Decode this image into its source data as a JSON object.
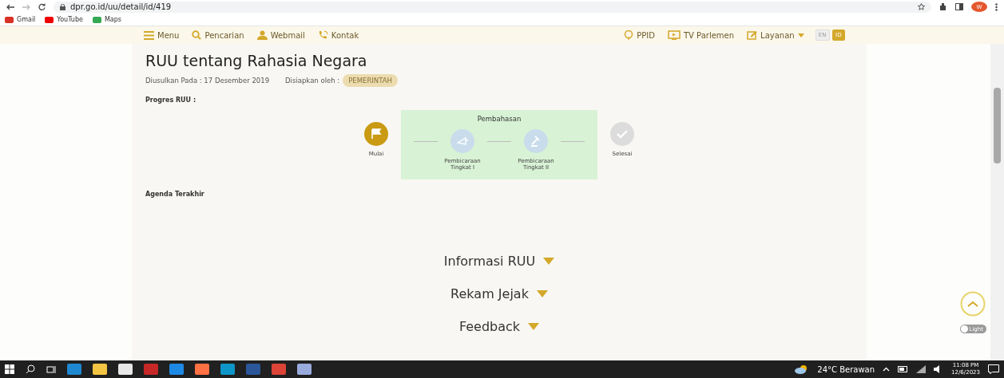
{
  "browser": {
    "url": "dpr.go.id/uu/detail/id/419",
    "bookmarks": [
      "Gmail",
      "YouTube",
      "Maps"
    ],
    "profile": "W"
  },
  "nav": {
    "left": [
      "Menu",
      "Pencarian",
      "Webmail",
      "Kontak"
    ],
    "right": [
      "PPID",
      "TV Parlemen",
      "Layanan"
    ],
    "languages": [
      {
        "label": "EN",
        "selected": false
      },
      {
        "label": "ID",
        "selected": true
      }
    ]
  },
  "bill": {
    "title": "RUU tentang Rahasia Negara",
    "proposed": "Diusulkan Pada : 17 Desember 2019",
    "prepared_label": "Disiapkan oleh :",
    "prepared_by": "PEMERINTAH",
    "progress_label": "Progres RUU :",
    "phase_label": "Pembahasan",
    "steps": [
      {
        "label": "Mulai",
        "done": true
      },
      {
        "label": "Pembicaraan Tingkat I",
        "done": false
      },
      {
        "label": "Pembicaraan Tingkat II",
        "done": false
      },
      {
        "label": "Selesai",
        "done": false
      }
    ],
    "agenda_label": "Agenda Terakhir"
  },
  "sections": [
    {
      "label": "Informasi RUU",
      "expanded": false
    },
    {
      "label": "Rekam Jejak",
      "expanded": false
    },
    {
      "label": "Feedback",
      "expanded": false
    }
  ],
  "theme_toggle": {
    "label": "Light"
  },
  "taskbar": {
    "weather": "24°C Berawan",
    "time": "11:08 PM",
    "date": "12/6/2023"
  }
}
